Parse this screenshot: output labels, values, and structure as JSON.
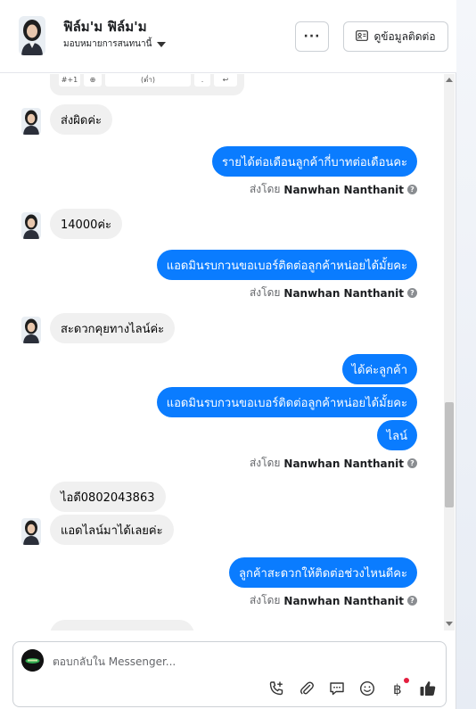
{
  "header": {
    "name": "ฟิล์ม'ม ฟิล์ม'ม",
    "assign_label": "มอบหมายการสนทนานี้",
    "more_label": "···",
    "contact_label": "ดูข้อมูลติดต่อ"
  },
  "keyboard_preview": {
    "keys": [
      "#+1",
      "⊕",
      "(ต่ำ)",
      ".",
      "↩"
    ]
  },
  "messages": [
    {
      "side": "in",
      "text": "ส่งผิดค่ะ"
    },
    {
      "side": "out",
      "text": "รายได้ต่อเดือนลูกค้ากี่บาทต่อเดือนคะ"
    },
    {
      "side": "in",
      "text": "14000ค่ะ"
    },
    {
      "side": "out",
      "text": "แอดมินรบกวนขอเบอร์ติดต่อลูกค้าหน่อยได้มั้ยคะ"
    },
    {
      "side": "in",
      "text": "สะดวกคุยทางไลน์ค่ะ"
    },
    {
      "side": "out",
      "text": "ได้ค่ะลูกค้า"
    },
    {
      "side": "out",
      "text": "แอดมินรบกวนขอเบอร์ติดต่อลูกค้าหน่อยได้มั้ยคะ"
    },
    {
      "side": "out",
      "text": "ไลน์"
    },
    {
      "side": "in",
      "text": "ไอดี0802043863"
    },
    {
      "side": "in",
      "text": "แอดไลน์มาได้เลยค่ะ"
    },
    {
      "side": "out",
      "text": "ลูกค้าสะดวกให้ติดต่อช่วงไหนดีคะ"
    }
  ],
  "sent_by": {
    "prefix": "ส่งโดย",
    "agent": "Nanwhan Nanthanit",
    "info": "?"
  },
  "composer": {
    "placeholder": "ตอบกลับใน Messenger...",
    "icons": [
      "phone-plus-icon",
      "paperclip-icon",
      "chat-bubble-icon",
      "emoji-icon",
      "baht-icon",
      "thumbs-up-icon"
    ]
  },
  "colors": {
    "outgoing": "#0a7cff",
    "incoming": "#f0f0f0",
    "notification_dot": "#e41e3f"
  }
}
